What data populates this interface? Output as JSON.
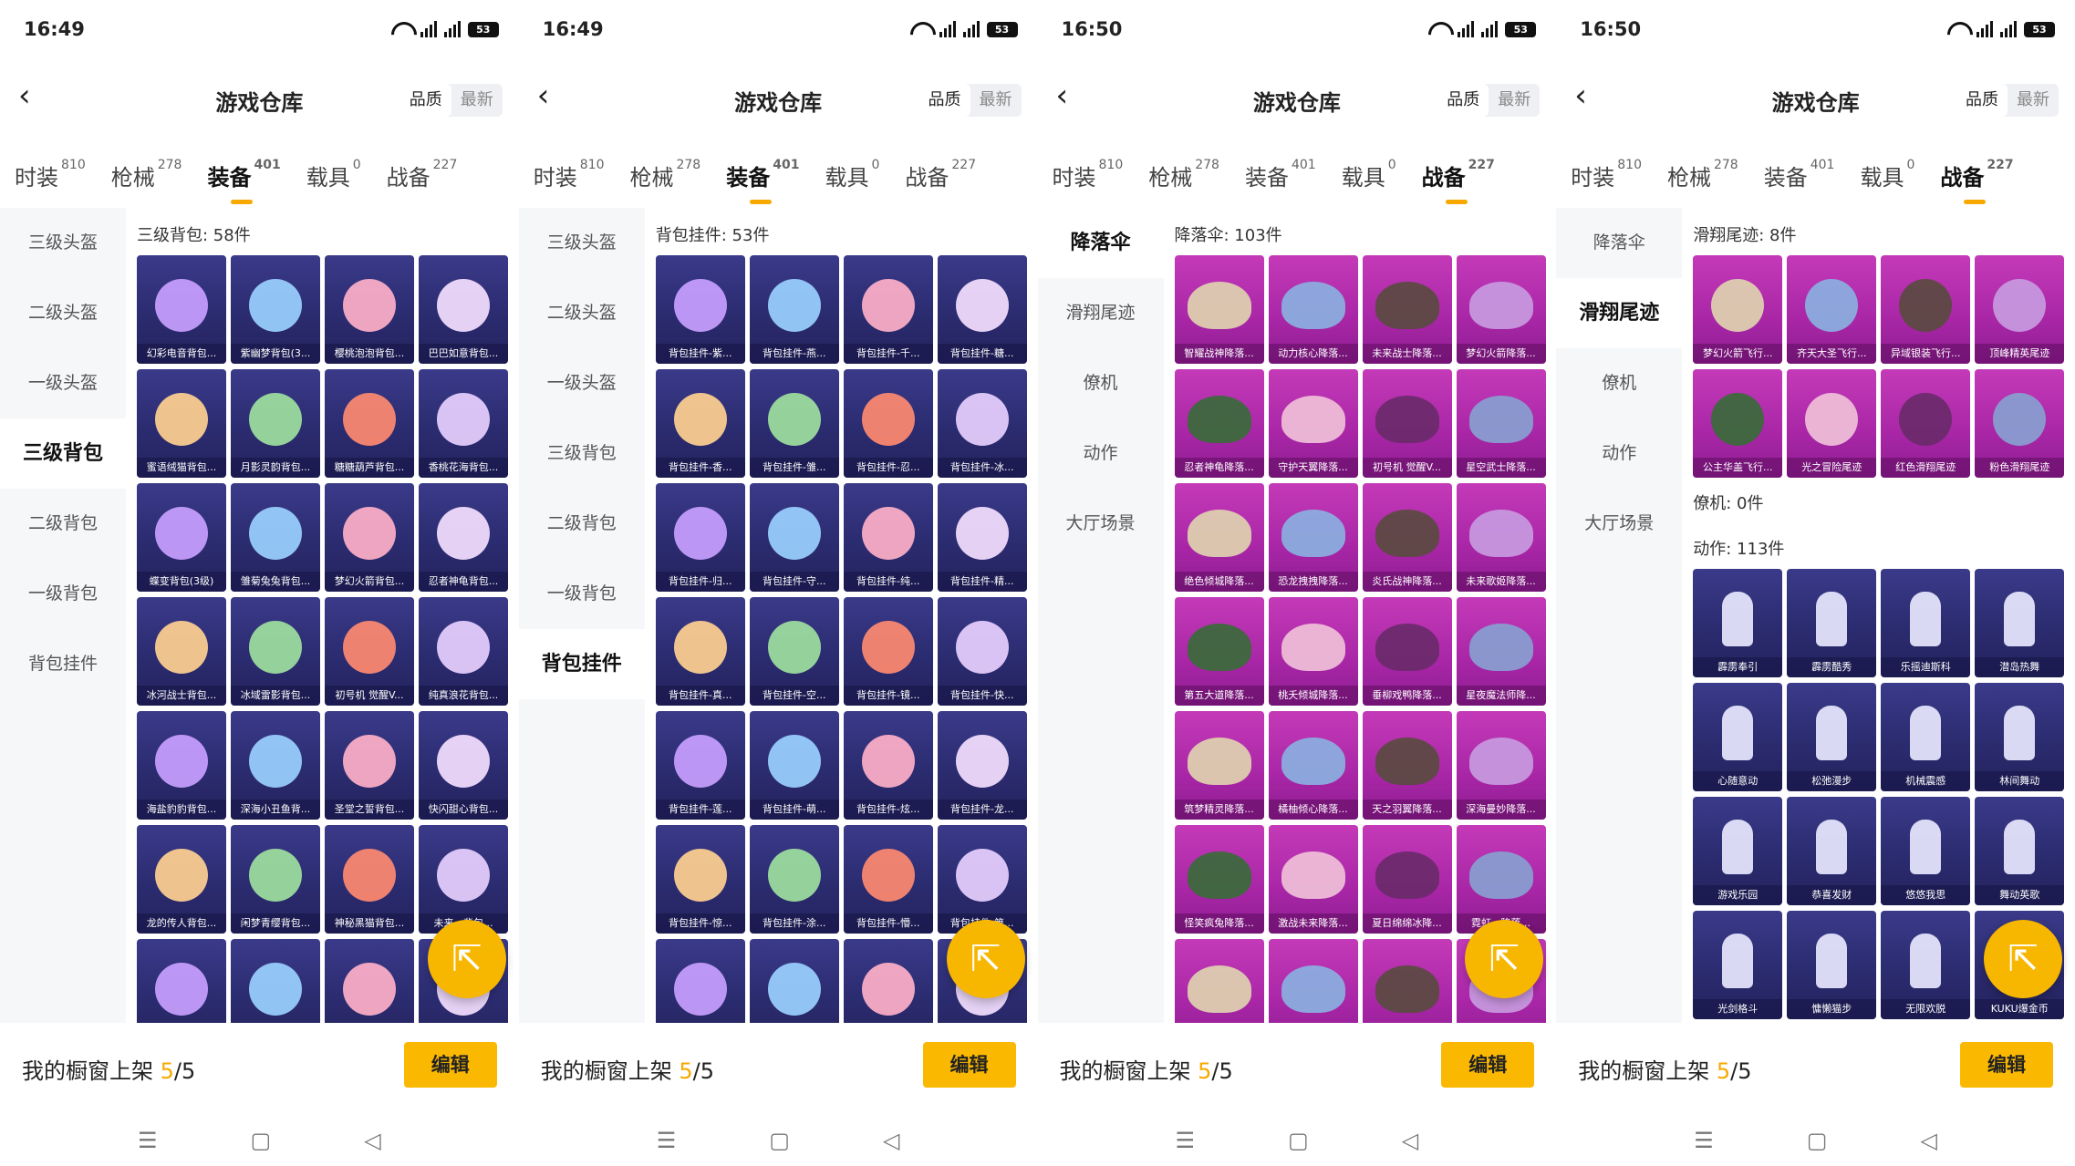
{
  "panels": [
    {
      "time": "16:49",
      "battery": "53",
      "title": "游戏仓库",
      "sort": [
        "品质",
        "最新"
      ],
      "tabs": [
        {
          "label": "时装",
          "count": "810"
        },
        {
          "label": "枪械",
          "count": "278"
        },
        {
          "label": "装备",
          "count": "401"
        },
        {
          "label": "载具",
          "count": "0"
        },
        {
          "label": "战备",
          "count": "227"
        }
      ],
      "active_tab": 2,
      "side": [
        "三级头盔",
        "二级头盔",
        "一级头盔",
        "三级背包",
        "二级背包",
        "一级背包",
        "背包挂件"
      ],
      "active_side": 3,
      "section": "三级背包: 58件",
      "items": [
        "幻彩电音背包...",
        "紫幽梦背包(3...",
        "樱桃泡泡背包...",
        "巴巴如意背包...",
        "蜜语绒猫背包...",
        "月影灵韵背包...",
        "糖糖葫芦背包...",
        "香桃花海背包...",
        "蝶变背包(3级)",
        "雏菊兔兔背包...",
        "梦幻火箭背包...",
        "忍者神龟背包...",
        "冰河战士背包...",
        "冰域雷影背包...",
        "初号机 觉醒V...",
        "纯真浪花背包...",
        "海盐豹豹背包...",
        "深海小丑鱼背...",
        "圣堂之誓背包...",
        "快闪甜心背包...",
        "龙的传人背包...",
        "闲梦青缨背包...",
        "神秘黑猫背包...",
        "未来...背包...",
        "",
        "",
        "",
        " "
      ],
      "footer": {
        "label": "我的橱窗上架",
        "cur": "5",
        "total": "/5",
        "edit": "编辑"
      }
    },
    {
      "time": "16:49",
      "battery": "53",
      "title": "游戏仓库",
      "sort": [
        "品质",
        "最新"
      ],
      "tabs": [
        {
          "label": "时装",
          "count": "810"
        },
        {
          "label": "枪械",
          "count": "278"
        },
        {
          "label": "装备",
          "count": "401"
        },
        {
          "label": "载具",
          "count": "0"
        },
        {
          "label": "战备",
          "count": "227"
        }
      ],
      "active_tab": 2,
      "side": [
        "三级头盔",
        "二级头盔",
        "一级头盔",
        "三级背包",
        "二级背包",
        "一级背包",
        "背包挂件"
      ],
      "active_side": 6,
      "section": "背包挂件: 53件",
      "items": [
        "背包挂件-紫...",
        "背包挂件-燕...",
        "背包挂件-千...",
        "背包挂件-糖...",
        "背包挂件-香...",
        "背包挂件-雏...",
        "背包挂件-忍...",
        "背包挂件-冰...",
        "背包挂件-归...",
        "背包挂件-守...",
        "背包挂件-纯...",
        "背包挂件-精...",
        "背包挂件-真...",
        "背包挂件-空...",
        "背包挂件-镜...",
        "背包挂件-快...",
        "背包挂件-莲...",
        "背包挂件-萌...",
        "背包挂件-炫...",
        "背包挂件-龙...",
        "背包挂件-惊...",
        "背包挂件-涂...",
        "背包挂件-懵...",
        "背包挂件-第...",
        "",
        "",
        "",
        ""
      ],
      "footer": {
        "label": "我的橱窗上架",
        "cur": "5",
        "total": "/5",
        "edit": "编辑"
      }
    },
    {
      "time": "16:50",
      "battery": "53",
      "title": "游戏仓库",
      "sort": [
        "品质",
        "最新"
      ],
      "tabs": [
        {
          "label": "时装",
          "count": "810"
        },
        {
          "label": "枪械",
          "count": "278"
        },
        {
          "label": "装备",
          "count": "401"
        },
        {
          "label": "载具",
          "count": "0"
        },
        {
          "label": "战备",
          "count": "227"
        }
      ],
      "active_tab": 4,
      "side": [
        "降落伞",
        "滑翔尾迹",
        "僚机",
        "动作",
        "大厅场景"
      ],
      "active_side": 0,
      "section": "降落伞: 103件",
      "items": [
        "智耀战神降落...",
        "动力核心降落...",
        "未来战士降落...",
        "梦幻火箭降落...",
        "忍者神龟降落...",
        "守护天翼降落...",
        "初号机 觉醒V...",
        "星空武士降落...",
        "绝色倾城降落...",
        "恐龙拽拽降落...",
        "炎氏战神降落...",
        "未来歌姬降落...",
        "第五大道降落...",
        "桃夭倾城降落...",
        "垂柳戏鸭降落...",
        "星夜魔法师降...",
        "筑梦精灵降落...",
        "橘柚倾心降落...",
        "天之羽翼降落...",
        "深海曼妙降落...",
        "怪笑疯兔降落...",
        "激战未来降落...",
        "夏日绵绵冰降...",
        "霓虹...降落...",
        "",
        "",
        "",
        ""
      ],
      "footer": {
        "label": "我的橱窗上架",
        "cur": "5",
        "total": "/5",
        "edit": "编辑"
      }
    },
    {
      "time": "16:50",
      "battery": "53",
      "title": "游戏仓库",
      "sort": [
        "品质",
        "最新"
      ],
      "tabs": [
        {
          "label": "时装",
          "count": "810"
        },
        {
          "label": "枪械",
          "count": "278"
        },
        {
          "label": "装备",
          "count": "401"
        },
        {
          "label": "载具",
          "count": "0"
        },
        {
          "label": "战备",
          "count": "227"
        }
      ],
      "active_tab": 4,
      "side": [
        "降落伞",
        "滑翔尾迹",
        "僚机",
        "动作",
        "大厅场景"
      ],
      "active_side": 1,
      "section": "滑翔尾迹: 8件",
      "items": [
        "梦幻火箭飞行...",
        "齐天大圣飞行...",
        "异域银装飞行...",
        "顶峰精英尾迹",
        "公主华盖飞行...",
        "光之冒险尾迹",
        "红色滑翔尾迹",
        "粉色滑翔尾迹"
      ],
      "section2": "僚机: 0件",
      "section3": "动作: 113件",
      "items2": [
        "霹雳奉引",
        "霹雳酷秀",
        "乐摇迪斯科",
        "潜岛热舞",
        "心随意动",
        "松弛漫步",
        "机械震感",
        "林间舞动",
        "游戏乐园",
        "恭喜发财",
        "悠悠我思",
        "舞动英歌",
        "光剑格斗",
        "慵懒猫步",
        "无限欢脱",
        "KUKU爆金币"
      ],
      "footer": {
        "label": "我的橱窗上架",
        "cur": "5",
        "total": "/5",
        "edit": "编辑"
      }
    }
  ],
  "colors": {
    "accent": "#f7a900",
    "card_blue": "#2e2e78",
    "card_pink": "#b42aac"
  },
  "icons": {
    "back": "back-arrow-icon",
    "fab": "share-external-icon",
    "nav": [
      "menu-icon",
      "home-square-icon",
      "back-triangle-icon"
    ]
  }
}
